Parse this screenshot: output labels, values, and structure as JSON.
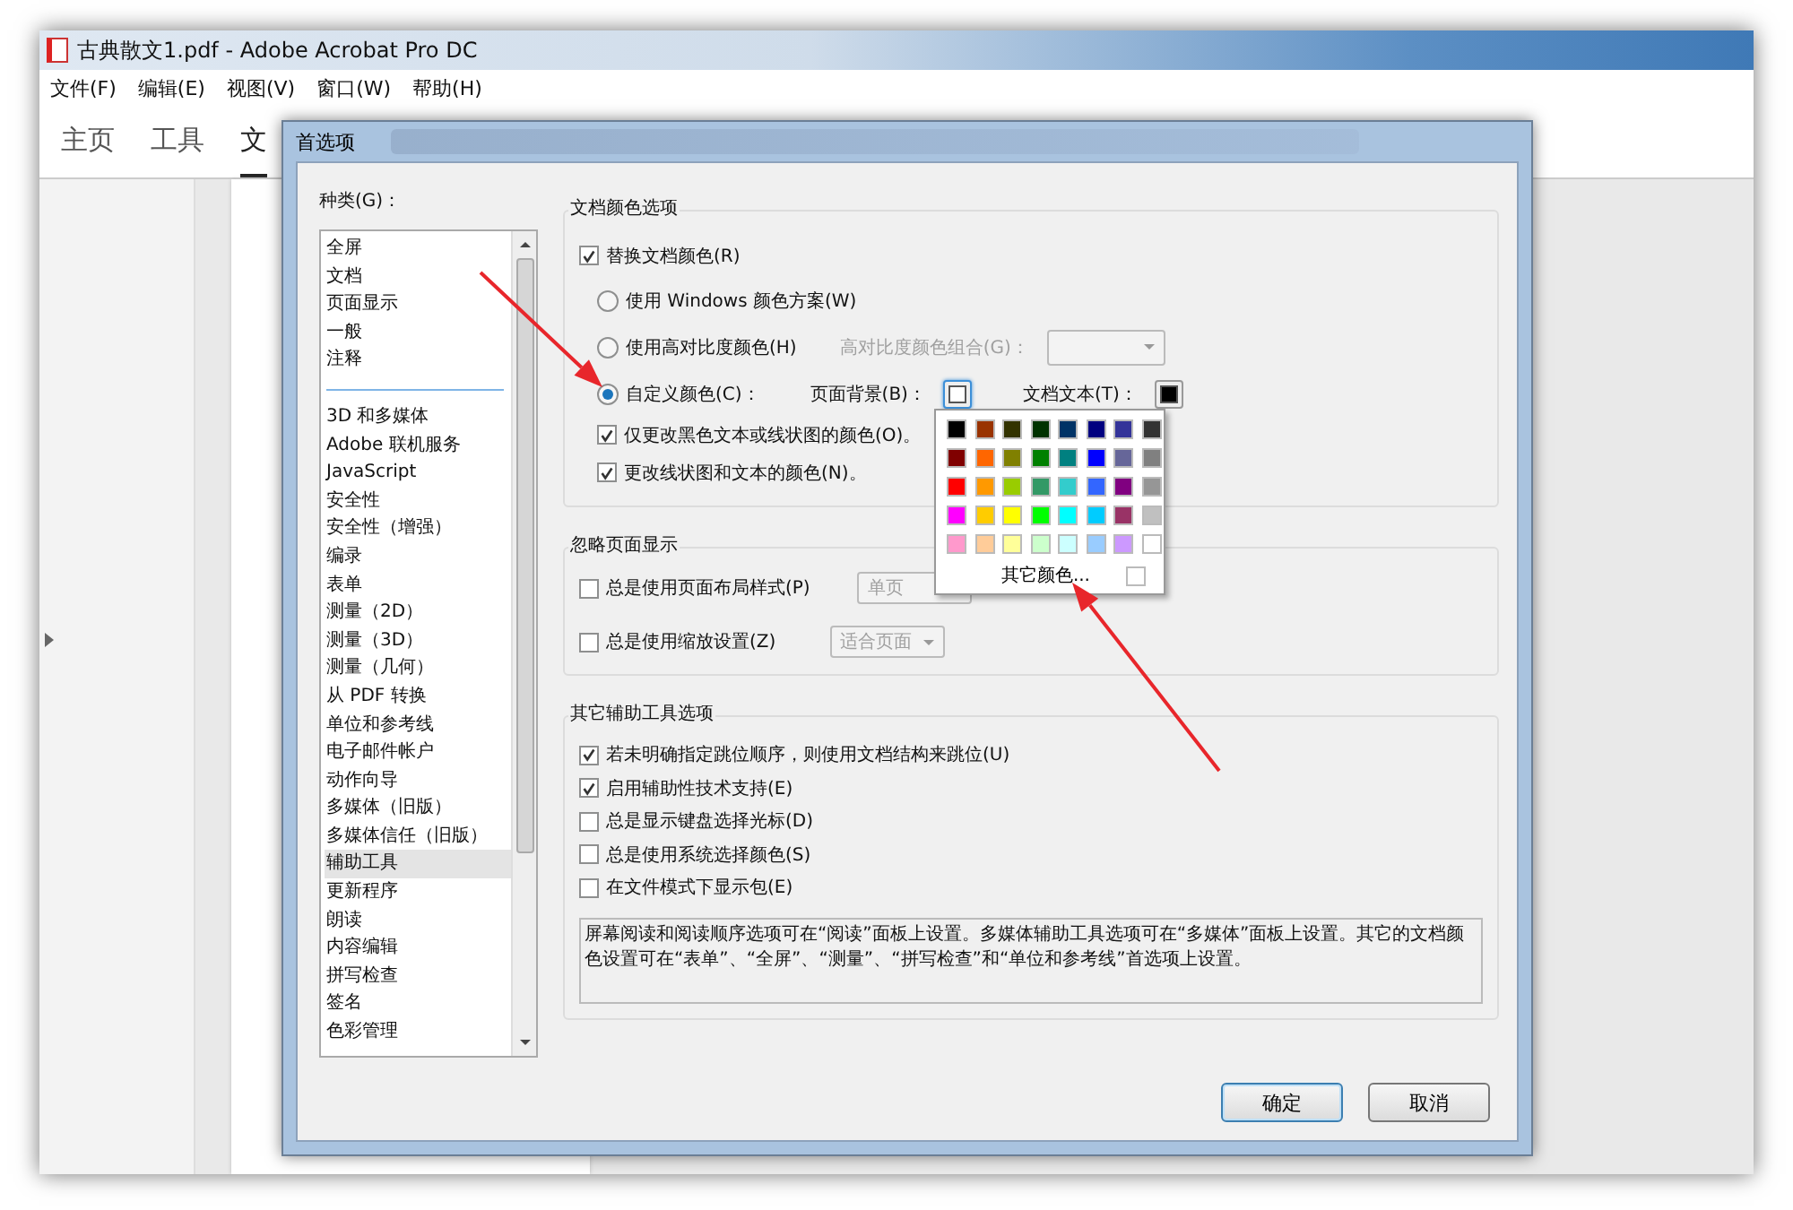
{
  "app": {
    "title": "古典散文1.pdf - Adobe Acrobat Pro DC",
    "menu": [
      "文件(F)",
      "编辑(E)",
      "视图(V)",
      "窗口(W)",
      "帮助(H)"
    ],
    "tabs": [
      {
        "label": "主页",
        "selected": false
      },
      {
        "label": "工具",
        "selected": false
      },
      {
        "label": "文",
        "selected": true
      }
    ]
  },
  "dialog": {
    "title": "首选项",
    "category_label": "种类(G)：",
    "category_groups": [
      [
        {
          "label": "全屏",
          "selected": false
        },
        {
          "label": "文档",
          "selected": false
        },
        {
          "label": "页面显示",
          "selected": false
        },
        {
          "label": "一般",
          "selected": false
        },
        {
          "label": "注释",
          "selected": false
        }
      ],
      [
        {
          "label": "3D 和多媒体",
          "selected": false
        },
        {
          "label": "Adobe 联机服务",
          "selected": false
        },
        {
          "label": "JavaScript",
          "selected": false
        },
        {
          "label": "安全性",
          "selected": false
        },
        {
          "label": "安全性（增强）",
          "selected": false
        },
        {
          "label": "编录",
          "selected": false
        },
        {
          "label": "表单",
          "selected": false
        },
        {
          "label": "测量（2D）",
          "selected": false
        },
        {
          "label": "测量（3D）",
          "selected": false
        },
        {
          "label": "测量（几何）",
          "selected": false
        },
        {
          "label": "从 PDF 转换",
          "selected": false
        },
        {
          "label": "单位和参考线",
          "selected": false
        },
        {
          "label": "电子邮件帐户",
          "selected": false
        },
        {
          "label": "动作向导",
          "selected": false
        },
        {
          "label": "多媒体（旧版）",
          "selected": false
        },
        {
          "label": "多媒体信任（旧版）",
          "selected": false
        },
        {
          "label": "辅助工具",
          "selected": true
        },
        {
          "label": "更新程序",
          "selected": false
        },
        {
          "label": "朗读",
          "selected": false
        },
        {
          "label": "内容编辑",
          "selected": false
        },
        {
          "label": "拼写检查",
          "selected": false
        },
        {
          "label": "签名",
          "selected": false
        },
        {
          "label": "色彩管理",
          "selected": false
        }
      ]
    ],
    "sections": [
      {
        "title": "文档颜色选项",
        "rows": [
          {
            "kind": "checkbox",
            "label": "替换文档颜色(R)",
            "checked": true
          },
          {
            "kind": "radio",
            "label": "使用 Windows 颜色方案(W)",
            "selected": false
          },
          {
            "kind": "radio",
            "label": "使用高对比度颜色(H)",
            "selected": false,
            "combo": {
              "label": "高对比度颜色组合(G)：",
              "disabled": true
            }
          },
          {
            "kind": "radio",
            "label": "自定义颜色(C)：",
            "selected": true,
            "swatches": [
              {
                "label": "页面背景(B)：",
                "color": "#ffffff",
                "focused": true
              },
              {
                "label": "文档文本(T)：",
                "color": "#000000",
                "focused": false
              }
            ]
          },
          {
            "kind": "subcheckbox",
            "label": "仅更改黑色文本或线状图的颜色(O)。",
            "checked": true
          },
          {
            "kind": "subcheckbox",
            "label": "更改线状图和文本的颜色(N)。",
            "checked": true
          }
        ]
      },
      {
        "title": "忽略页面显示",
        "rows": [
          {
            "kind": "checkbox",
            "label": "总是使用页面布局样式(P)",
            "checked": false,
            "dropdown": {
              "value": "单页",
              "disabled": true
            }
          },
          {
            "kind": "checkbox",
            "label": "总是使用缩放设置(Z)",
            "checked": false,
            "dropdown": {
              "value": "适合页面",
              "disabled": true
            }
          }
        ]
      },
      {
        "title": "其它辅助工具选项",
        "rows": [
          {
            "kind": "checkbox",
            "label": "若未明确指定跳位顺序，则使用文档结构来跳位(U)",
            "checked": true
          },
          {
            "kind": "checkbox",
            "label": "启用辅助性技术支持(E)",
            "checked": true
          },
          {
            "kind": "checkbox",
            "label": "总是显示键盘选择光标(D)",
            "checked": false
          },
          {
            "kind": "checkbox",
            "label": "总是使用系统选择颜色(S)",
            "checked": false
          },
          {
            "kind": "checkbox",
            "label": "在文件模式下显示包(E)",
            "checked": false
          }
        ],
        "note": "屏幕阅读和阅读顺序选项可在“阅读”面板上设置。多媒体辅助工具选项可在“多媒体”面板上设置。其它的文档颜色设置可在“表单”、“全屏”、“测量”、“拼写检查”和“单位和参考线”首选项上设置。"
      }
    ],
    "color_picker": {
      "colors": [
        {
          "color": "#000000"
        },
        {
          "color": "#993300"
        },
        {
          "color": "#333300"
        },
        {
          "color": "#003300"
        },
        {
          "color": "#003366"
        },
        {
          "color": "#000080"
        },
        {
          "color": "#333399"
        },
        {
          "color": "#333333"
        },
        {
          "color": "#800000"
        },
        {
          "color": "#ff6600"
        },
        {
          "color": "#808000"
        },
        {
          "color": "#008000"
        },
        {
          "color": "#008080"
        },
        {
          "color": "#0000ff"
        },
        {
          "color": "#666699"
        },
        {
          "color": "#808080"
        },
        {
          "color": "#ff0000"
        },
        {
          "color": "#ff9900"
        },
        {
          "color": "#99cc00"
        },
        {
          "color": "#339966"
        },
        {
          "color": "#33cccc"
        },
        {
          "color": "#3366ff"
        },
        {
          "color": "#800080"
        },
        {
          "color": "#969696"
        },
        {
          "color": "#ff00ff"
        },
        {
          "color": "#ffcc00"
        },
        {
          "color": "#ffff00"
        },
        {
          "color": "#00ff00"
        },
        {
          "color": "#00ffff"
        },
        {
          "color": "#00ccff"
        },
        {
          "color": "#993366"
        },
        {
          "color": "#c0c0c0"
        },
        {
          "color": "#ff99cc"
        },
        {
          "color": "#ffcc99"
        },
        {
          "color": "#ffff99"
        },
        {
          "color": "#ccffcc"
        },
        {
          "color": "#ccffff"
        },
        {
          "color": "#99ccff"
        },
        {
          "color": "#cc99ff"
        },
        {
          "color": "#ffffff"
        }
      ],
      "more_label": "其它颜色..."
    },
    "buttons": [
      {
        "label": "确定",
        "default": true
      },
      {
        "label": "取消",
        "default": false
      }
    ]
  }
}
